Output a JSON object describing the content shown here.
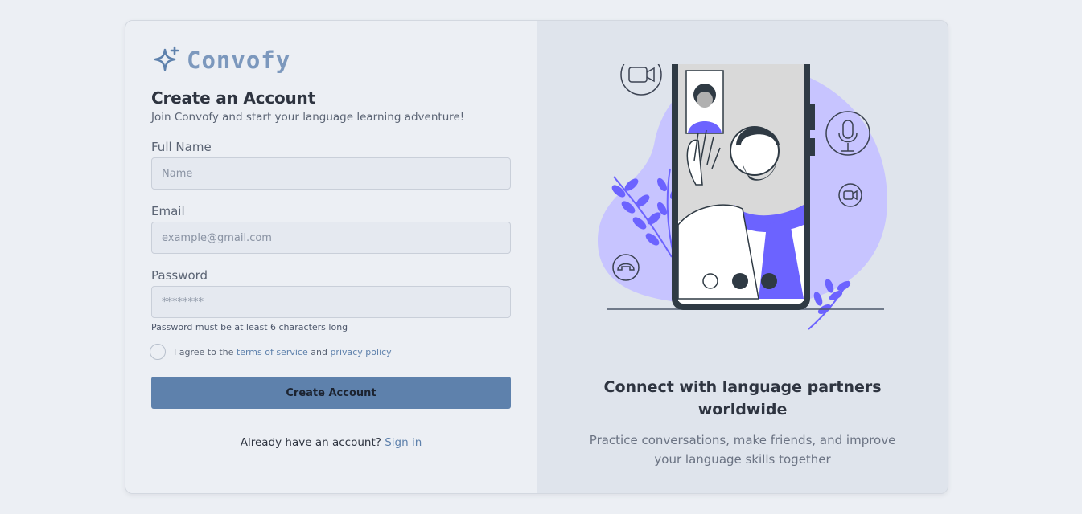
{
  "brand": {
    "name": "Convofy",
    "icon": "sparkle-icon",
    "color": "#7c98bd"
  },
  "form": {
    "title": "Create an Account",
    "subtitle": "Join Convofy and start your language learning adventure!",
    "full_name": {
      "label": "Full Name",
      "placeholder": "Name",
      "value": ""
    },
    "email": {
      "label": "Email",
      "placeholder": "example@gmail.com",
      "value": ""
    },
    "password": {
      "label": "Password",
      "placeholder": "********",
      "value": "",
      "hint": "Password must be at least 6 characters long"
    },
    "agree": {
      "checked": false,
      "prefix": "I agree to the ",
      "terms_link": "terms of service",
      "middle": " and ",
      "privacy_link": "privacy policy"
    },
    "submit_label": "Create Account",
    "signin": {
      "prompt": "Already have an account? ",
      "link": "Sign in"
    }
  },
  "promo": {
    "illustration": "video-call-illustration",
    "title": "Connect with language partners worldwide",
    "subtitle": "Practice conversations, make friends, and improve your language skills together"
  },
  "colors": {
    "accent": "#5e81ac",
    "illustration_purple": "#6c63ff",
    "blob": "#c7c4ff"
  }
}
